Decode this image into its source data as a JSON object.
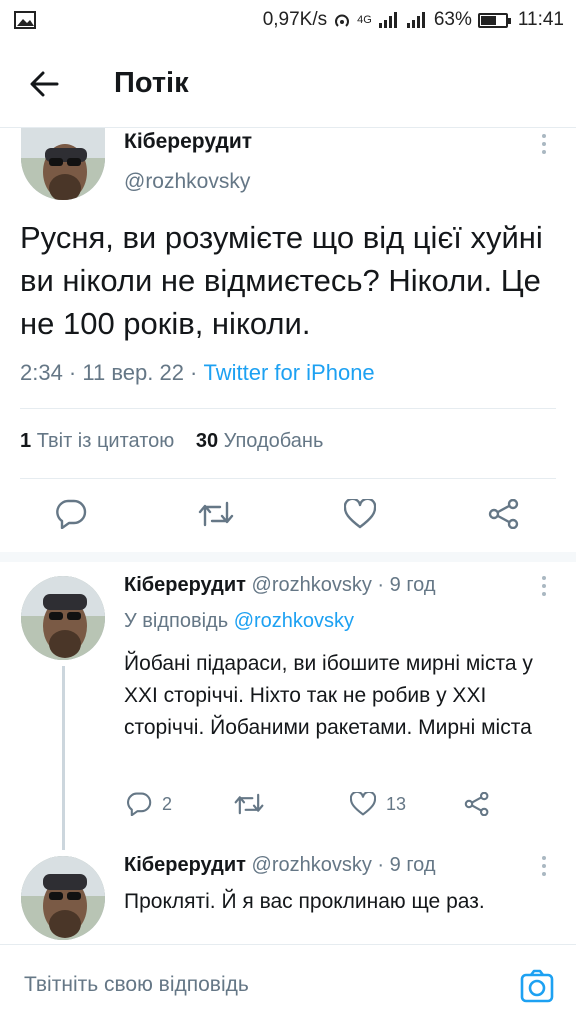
{
  "status_bar": {
    "speed": "0,97K/s",
    "network": "4G",
    "battery_percent": "63%",
    "battery_level": 0.63,
    "time": "11:41"
  },
  "header": {
    "title": "Потік",
    "back_icon": "arrow-left-icon"
  },
  "main_tweet": {
    "author_name": "Кіберерудит",
    "author_handle": "@rozhkovsky",
    "text": "Русня, ви розумієте що від цієї хуйні ви ніколи не відмиєтесь? Ніколи. Це не 100 років, ніколи.",
    "meta_time": "2:34 · 11 вер. 22 · ",
    "meta_source": "Twitter for iPhone",
    "stats": {
      "quotes_count": "1",
      "quotes_label": "Твіт із цитатою",
      "likes_count": "30",
      "likes_label": "Уподобань"
    }
  },
  "replies": [
    {
      "author_name": "Кіберерудит",
      "author_handle": "@rozhkovsky",
      "time": "· 9 год",
      "reply_to_label": "У відповідь",
      "reply_to_handle": "@rozhkovsky",
      "text": "Йобані підараси, ви ібошите мирні міста у XXI сторіччі. Ніхто так не робив у XXI сторіччі. Йобаними ракетами. Мирні міста",
      "reply_count": "2",
      "retweet_count": "",
      "like_count": "13"
    },
    {
      "author_name": "Кіберерудит",
      "author_handle": "@rozhkovsky",
      "time": "· 9 год",
      "text": "Прокляті. Й я вас проклинаю ще раз."
    }
  ],
  "compose": {
    "placeholder": "Твітніть свою відповідь",
    "camera_icon": "camera-icon"
  },
  "colors": {
    "accent": "#1da1f2",
    "muted": "#657786",
    "text": "#14171a",
    "divider": "#e6ecf0"
  }
}
